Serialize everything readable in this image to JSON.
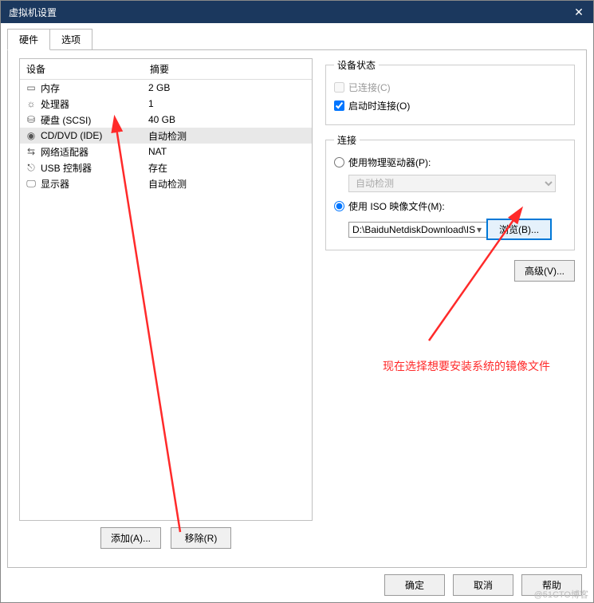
{
  "window": {
    "title": "虚拟机设置"
  },
  "tabs": {
    "hardware": "硬件",
    "options": "选项"
  },
  "list": {
    "header_device": "设备",
    "header_summary": "摘要",
    "rows": [
      {
        "name": "内存",
        "summary": "2 GB",
        "icon": "memory"
      },
      {
        "name": "处理器",
        "summary": "1",
        "icon": "cpu"
      },
      {
        "name": "硬盘 (SCSI)",
        "summary": "40 GB",
        "icon": "disk"
      },
      {
        "name": "CD/DVD (IDE)",
        "summary": "自动检测",
        "icon": "disc"
      },
      {
        "name": "网络适配器",
        "summary": "NAT",
        "icon": "network"
      },
      {
        "name": "USB 控制器",
        "summary": "存在",
        "icon": "usb"
      },
      {
        "name": "显示器",
        "summary": "自动检测",
        "icon": "display"
      }
    ]
  },
  "buttons": {
    "add": "添加(A)...",
    "remove": "移除(R)",
    "advanced": "高级(V)...",
    "browse": "浏览(B)...",
    "ok": "确定",
    "cancel": "取消",
    "help": "帮助"
  },
  "status": {
    "legend": "设备状态",
    "connected": "已连接(C)",
    "connect_power_on": "启动时连接(O)"
  },
  "connection": {
    "legend": "连接",
    "physical": "使用物理驱动器(P):",
    "physical_value": "自动检测",
    "iso": "使用 ISO 映像文件(M):",
    "iso_path": "D:\\BaiduNetdiskDownload\\IS"
  },
  "annotation": "现在选择想要安装系统的镜像文件",
  "watermark": "@51CTO博客"
}
